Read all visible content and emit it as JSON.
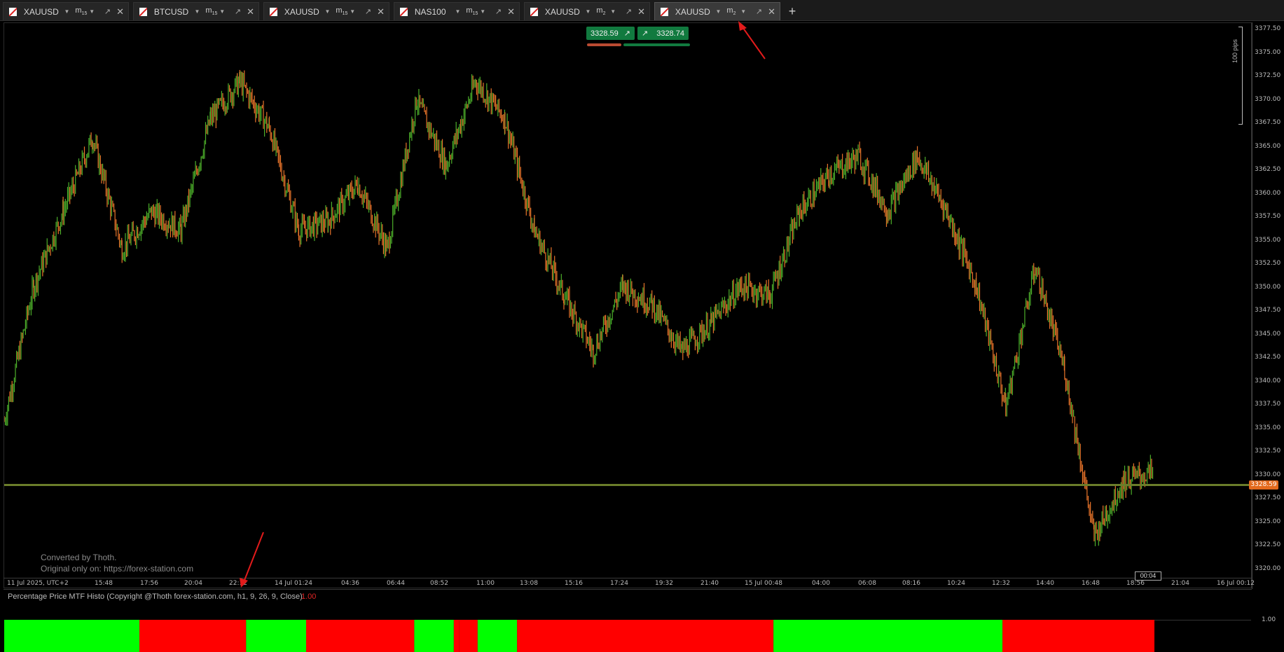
{
  "tabs": [
    {
      "symbol": "XAUUSD",
      "tf": "m",
      "tf_sub": "15",
      "active": false
    },
    {
      "symbol": "BTCUSD",
      "tf": "m",
      "tf_sub": "15",
      "active": false
    },
    {
      "symbol": "XAUUSD",
      "tf": "m",
      "tf_sub": "15",
      "active": false
    },
    {
      "symbol": "NAS100",
      "tf": "m",
      "tf_sub": "15",
      "active": false
    },
    {
      "symbol": "XAUUSD",
      "tf": "m",
      "tf_sub": "2",
      "active": false
    },
    {
      "symbol": "XAUUSD",
      "tf": "m",
      "tf_sub": "2",
      "active": true
    }
  ],
  "new_tab_label": "+",
  "bid_ask": {
    "bid": "3328.59",
    "ask": "3328.74"
  },
  "pips_label": "100 pips",
  "current_price": "3328.59",
  "countdown": "00:04",
  "watermark": {
    "line1": "Converted by Thoth.",
    "line2": "Original only on: https://forex-station.com"
  },
  "y_axis_labels": [
    "3377.50",
    "3375.00",
    "3372.50",
    "3370.00",
    "3367.50",
    "3365.00",
    "3362.50",
    "3360.00",
    "3357.50",
    "3355.00",
    "3352.50",
    "3350.00",
    "3347.50",
    "3345.00",
    "3342.50",
    "3340.00",
    "3337.50",
    "3335.00",
    "3332.50",
    "3330.00",
    "3327.50",
    "3325.00",
    "3322.50",
    "3320.00"
  ],
  "time_labels": [
    "11 Jul 2025, UTC+2",
    "15:48",
    "17:56",
    "20:04",
    "22:12",
    "14 Jul 01:24",
    "04:36",
    "06:44",
    "08:52",
    "11:00",
    "13:08",
    "15:16",
    "17:24",
    "19:32",
    "21:40",
    "15 Jul 00:48",
    "04:00",
    "06:08",
    "08:16",
    "10:24",
    "12:32",
    "14:40",
    "16:48",
    "18:56",
    "21:04",
    "16 Jul 00:12"
  ],
  "indicator": {
    "title": "Percentage Price MTF Histo (Copyright @Thoth forex-station.com, h1, 9, 26, 9, Close)",
    "value": "1.00",
    "y_label": "1.00"
  },
  "colors": {
    "bull": "#4caf2a",
    "bear": "#e8742a",
    "histo_green": "#00ff00",
    "histo_red": "#ff0000",
    "current_line": "#6b7d2a"
  },
  "chart_data": {
    "type": "line",
    "title": "",
    "xlabel": "",
    "ylabel": "",
    "ylim": [
      3318.6,
      3378.3
    ],
    "x": [
      "11 Jul 2025, UTC+2",
      "15:48",
      "17:56",
      "20:04",
      "22:12",
      "14 Jul 01:24",
      "04:36",
      "06:44",
      "08:52",
      "11:00",
      "13:08",
      "15:16",
      "17:24",
      "19:32",
      "21:40",
      "15 Jul 00:48",
      "04:00",
      "06:08",
      "08:16",
      "10:24",
      "12:32",
      "14:40",
      "16:48",
      "18:56"
    ],
    "series": [
      {
        "values": [
          3335.5,
          3350,
          3358,
          3366,
          3354,
          3358,
          3356,
          3368,
          3372,
          3367,
          3356,
          3357,
          3361,
          3354,
          3370,
          3363,
          3372,
          3368,
          3356,
          3349,
          3343,
          3350,
          3348,
          3343,
          3346,
          3350,
          3349,
          3358,
          3362,
          3364,
          3358,
          3364,
          3358,
          3350,
          3337,
          3352,
          3341,
          3323,
          3329,
          3330
        ]
      }
    ]
  },
  "histogram": {
    "type": "bar",
    "values": [
      1,
      1,
      -1,
      -1,
      1,
      -1,
      -1,
      1,
      -1,
      1,
      -1,
      -1,
      -1,
      1,
      1,
      1,
      1,
      -1,
      -1
    ],
    "segments": [
      {
        "sign": 1,
        "from": 0.0,
        "to": 0.1176
      },
      {
        "sign": -1,
        "from": 0.1176,
        "to": 0.2103
      },
      {
        "sign": 1,
        "from": 0.2103,
        "to": 0.2625
      },
      {
        "sign": -1,
        "from": 0.2625,
        "to": 0.3565
      },
      {
        "sign": 1,
        "from": 0.3565,
        "to": 0.3909
      },
      {
        "sign": -1,
        "from": 0.3909,
        "to": 0.3954
      },
      {
        "sign": -1,
        "from": 0.3954,
        "to": 0.4116
      },
      {
        "sign": 1,
        "from": 0.4116,
        "to": 0.4459
      },
      {
        "sign": -1,
        "from": 0.4459,
        "to": 0.6688
      },
      {
        "sign": 1,
        "from": 0.6688,
        "to": 0.8679
      },
      {
        "sign": -1,
        "from": 0.8679,
        "to": 1.0
      }
    ]
  }
}
